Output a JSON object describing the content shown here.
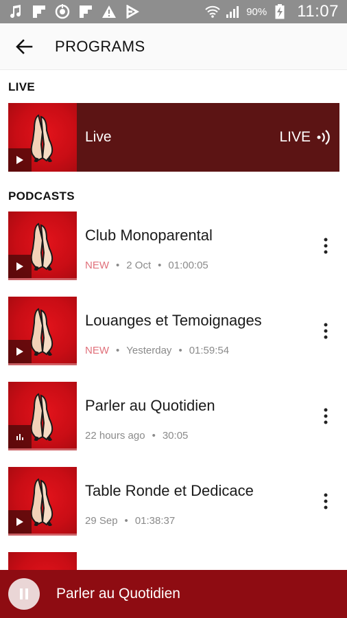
{
  "status_bar": {
    "battery_percent": "90%",
    "time": "11:07",
    "icons": [
      "music-icon",
      "flipboard-icon",
      "sync-icon",
      "flipboard-icon",
      "warning-icon",
      "feedly-icon",
      "wifi-icon",
      "signal-icon",
      "battery-charging-icon"
    ]
  },
  "app_bar": {
    "title": "PROGRAMS"
  },
  "sections": {
    "live": "LIVE",
    "podcasts": "PODCASTS"
  },
  "live": {
    "name": "Live",
    "badge": "LIVE"
  },
  "podcasts": [
    {
      "title": "Club Monoparental",
      "new": "NEW",
      "date": "2 Oct",
      "duration": "01:00:05",
      "state": "play"
    },
    {
      "title": "Louanges et Temoignages",
      "new": "NEW",
      "date": "Yesterday",
      "duration": "01:59:54",
      "state": "play"
    },
    {
      "title": "Parler au Quotidien",
      "new": "",
      "date": "22 hours ago",
      "duration": "30:05",
      "state": "playing"
    },
    {
      "title": "Table Ronde et Dedicace",
      "new": "",
      "date": "29 Sep",
      "duration": "01:38:37",
      "state": "play"
    }
  ],
  "player": {
    "title": "Parler au Quotidien"
  },
  "colors": {
    "brand_red": "#c90d15",
    "live_bg": "#5c1414",
    "player_bg": "#8e0c12",
    "new_label": "#e0707a"
  }
}
